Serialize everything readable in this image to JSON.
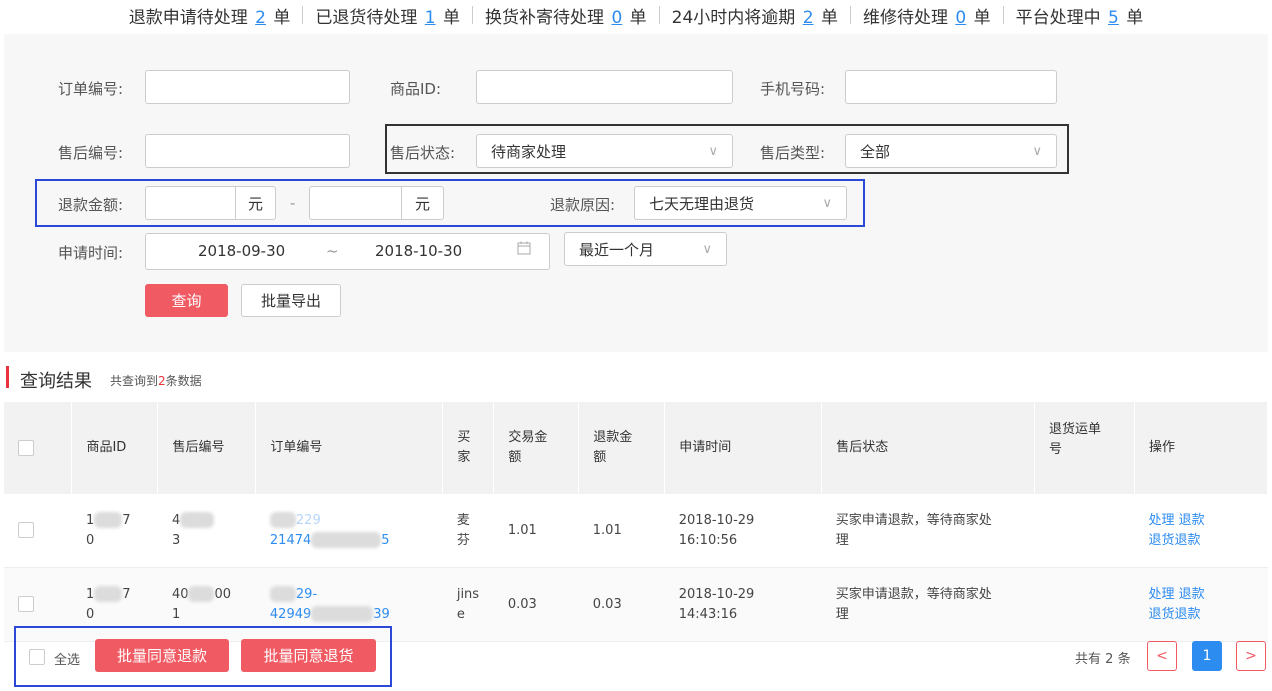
{
  "stats": [
    {
      "label": "退款申请待处理",
      "value": "2",
      "unit": "单"
    },
    {
      "label": "已退货待处理",
      "value": "1",
      "unit": "单"
    },
    {
      "label": "换货补寄待处理",
      "value": "0",
      "unit": "单"
    },
    {
      "label": "24小时内将逾期",
      "value": "2",
      "unit": "单"
    },
    {
      "label": "维修待处理",
      "value": "0",
      "unit": "单"
    },
    {
      "label": "平台处理中",
      "value": "5",
      "unit": "单"
    }
  ],
  "filter": {
    "order_no_label": "订单编号:",
    "product_id_label": "商品ID:",
    "phone_label": "手机号码:",
    "aftersale_no_label": "售后编号:",
    "aftersale_status_label": "售后状态:",
    "aftersale_status_value": "待商家处理",
    "aftersale_type_label": "售后类型:",
    "aftersale_type_value": "全部",
    "refund_amount_label": "退款金额:",
    "yuan": "元",
    "dash": "-",
    "refund_reason_label": "退款原因:",
    "refund_reason_value": "七天无理由退货",
    "apply_time_label": "申请时间:",
    "date_start": "2018-09-30",
    "date_tilde": "~",
    "date_end": "2018-10-30",
    "range_value": "最近一个月",
    "query_button": "查询",
    "export_button": "批量导出"
  },
  "results": {
    "title": "查询结果",
    "count_prefix": "共查询到",
    "count": "2",
    "count_suffix": "条数据"
  },
  "table": {
    "headers": {
      "product_id": "商品ID",
      "aftersale_no": "售后编号",
      "order_no": "订单编号",
      "buyer_1": "买",
      "buyer_2": "家",
      "trade_1": "交易金",
      "trade_2": "额",
      "refund_1": "退款金",
      "refund_2": "额",
      "apply_time": "申请时间",
      "status": "售后状态",
      "tracking_1": "退货运单",
      "tracking_2": "号",
      "action": "操作"
    },
    "rows": [
      {
        "pid_a": "1",
        "pid_b": "7",
        "pid_c": "0",
        "asn_a": "4",
        "asn_c": "3",
        "order_a": "229",
        "order_b": "21474",
        "order_c": "5",
        "buyer_1": "麦",
        "buyer_2": "芬",
        "trade": "1.01",
        "refund": "1.01",
        "date": "2018-10-29",
        "time": "16:10:56",
        "status_1": "买家申请退款，等待商家处",
        "status_2": "理",
        "act_process": "处理",
        "act_refund": "退款",
        "act_return": "退货退款"
      },
      {
        "pid_a": "1",
        "pid_b": "7",
        "pid_c": "0",
        "asn_a": "40",
        "asn_b": "00",
        "asn_c": "1",
        "order_a": "29-",
        "order_b": "42949",
        "order_c": "39",
        "buyer_1": "jins",
        "buyer_2": "e",
        "trade": "0.03",
        "refund": "0.03",
        "date": "2018-10-29",
        "time": "14:43:16",
        "status_1": "买家申请退款，等待商家处",
        "status_2": "理",
        "act_process": "处理",
        "act_refund": "退款",
        "act_return": "退货退款"
      }
    ]
  },
  "footer": {
    "select_all": "全选",
    "batch_refund": "批量同意退款",
    "batch_return": "批量同意退货",
    "total_prefix": "共有",
    "total": "2",
    "total_suffix": "条",
    "prev": "<",
    "page": "1",
    "next": ">"
  },
  "colors": {
    "accent_red": "#f05a63",
    "link_blue": "#2d8cf0",
    "highlight_blue": "#2b48d6",
    "highlight_black": "#333333"
  }
}
